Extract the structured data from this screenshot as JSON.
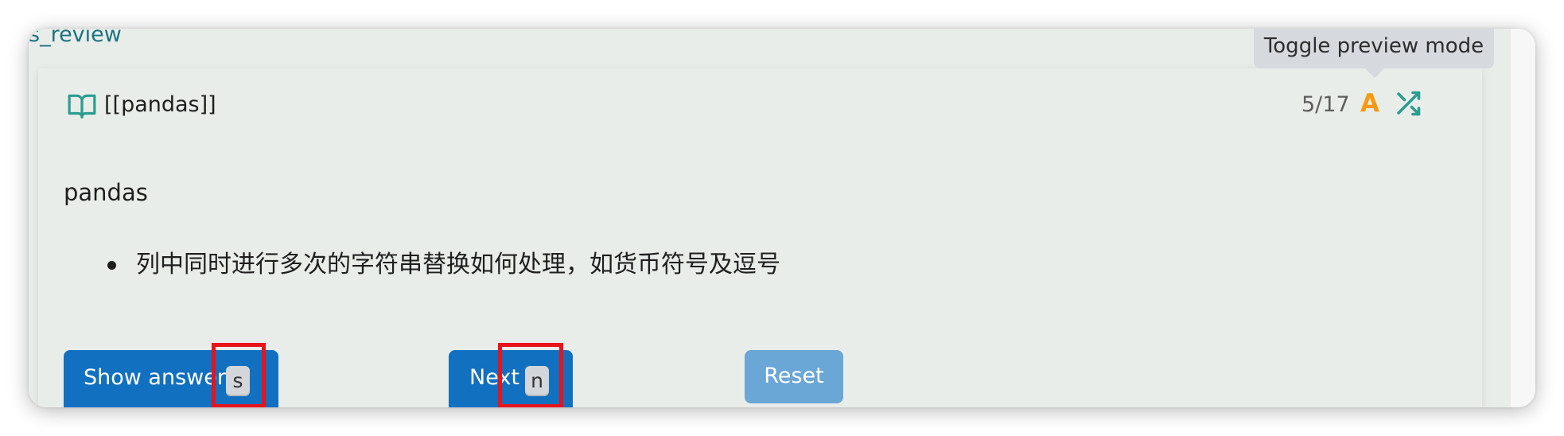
{
  "page": {
    "title": "s_review"
  },
  "card": {
    "note_link": "[[pandas]]",
    "counter": "5/17",
    "preview_mode_icon": "A",
    "tooltip": "Toggle preview mode",
    "question": {
      "heading": "pandas",
      "bullets": [
        "列中同时进行多次的字符串替换如何处理，如货币符号及逗号"
      ]
    }
  },
  "buttons": {
    "show_answers": {
      "label": "Show answers",
      "shortcut": "s"
    },
    "next": {
      "label": "Next",
      "shortcut": "n"
    },
    "reset": {
      "label": "Reset"
    }
  },
  "icons": {
    "note": "book-icon",
    "preview": "preview-mode-icon",
    "shuffle": "shuffle-icon"
  },
  "colors": {
    "accent_teal": "#2a9d8f",
    "preview_orange": "#f59a12",
    "primary_button": "#1270c0",
    "disabled_button": "#6aa6d6",
    "highlight_red": "#e8131b"
  }
}
